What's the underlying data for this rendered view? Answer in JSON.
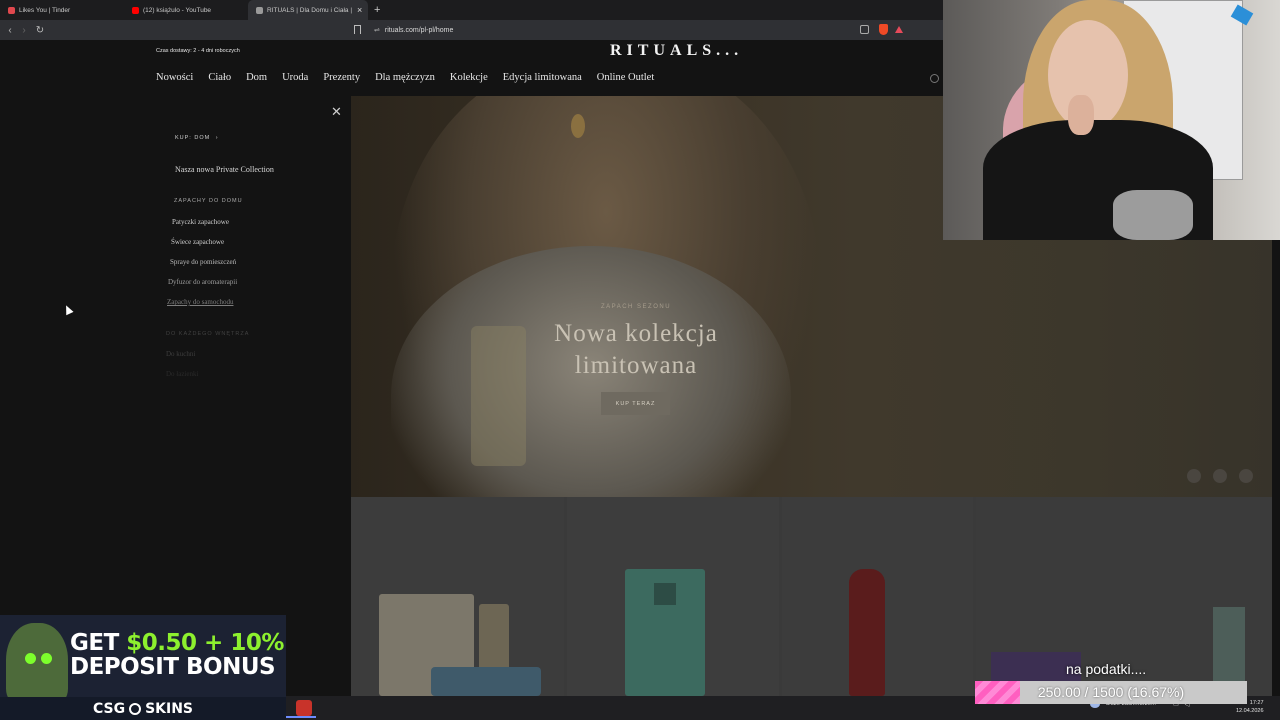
{
  "browser": {
    "tabs": [
      {
        "title": "Likes You | Tinder",
        "active": false,
        "favicon_color": "#e0484e"
      },
      {
        "title": "(12) książulo - YouTube",
        "active": false,
        "favicon_color": "#ff0000"
      },
      {
        "title": "RITUALS | Dla Domu i Ciała | Oficj",
        "active": true,
        "favicon_color": "#9a9a9a"
      }
    ],
    "new_tab_label": "+",
    "close_tab_label": "×",
    "url": "rituals.com/pl-pl/home"
  },
  "site": {
    "delivery_text": "Czas dostawy: 2 - 4 dni roboczych",
    "logo": "RITUALS...",
    "nav": [
      "Nowości",
      "Ciało",
      "Dom",
      "Uroda",
      "Prezenty",
      "Dla mężczyzn",
      "Kolekcje",
      "Edycja limitowana",
      "Online Outlet"
    ],
    "menu": {
      "shop_link": "KUP: DOM",
      "private_collection": "Nasza nowa Private Collection",
      "section_title": "ZAPACHY DO DOMU",
      "items": [
        "Patyczki zapachowe",
        "Świece zapachowe",
        "Spraye do pomieszczeń",
        "Dyfuzor do aromaterapii",
        "Zapachy do samochodu"
      ],
      "section_title_2": "DO KAŻDEGO WNĘTRZA",
      "items_2": [
        "Do kuchni",
        "Do łazienki"
      ]
    },
    "hero": {
      "eyebrow": "ZAPACH SEZONU",
      "title_line1": "Nowa kolekcja",
      "title_line2": "limitowana",
      "button": "KUP TERAZ"
    }
  },
  "ad": {
    "line1_prefix": "GET ",
    "line1_highlight": "$0.50 + 10%",
    "line2": "DEPOSIT BONUS",
    "brand_left": "CSG",
    "brand_right": "SKINS"
  },
  "taskbar": {
    "weather": "Duże zachmurze...",
    "time": "17:27",
    "date": "12.04.2026"
  },
  "goal": {
    "label": "na podatki....",
    "text": "250.00 / 1500 (16.67%)",
    "current": 250,
    "target": 1500,
    "fill_fraction": 0.1667,
    "fill_color": "#ff6fcb"
  }
}
